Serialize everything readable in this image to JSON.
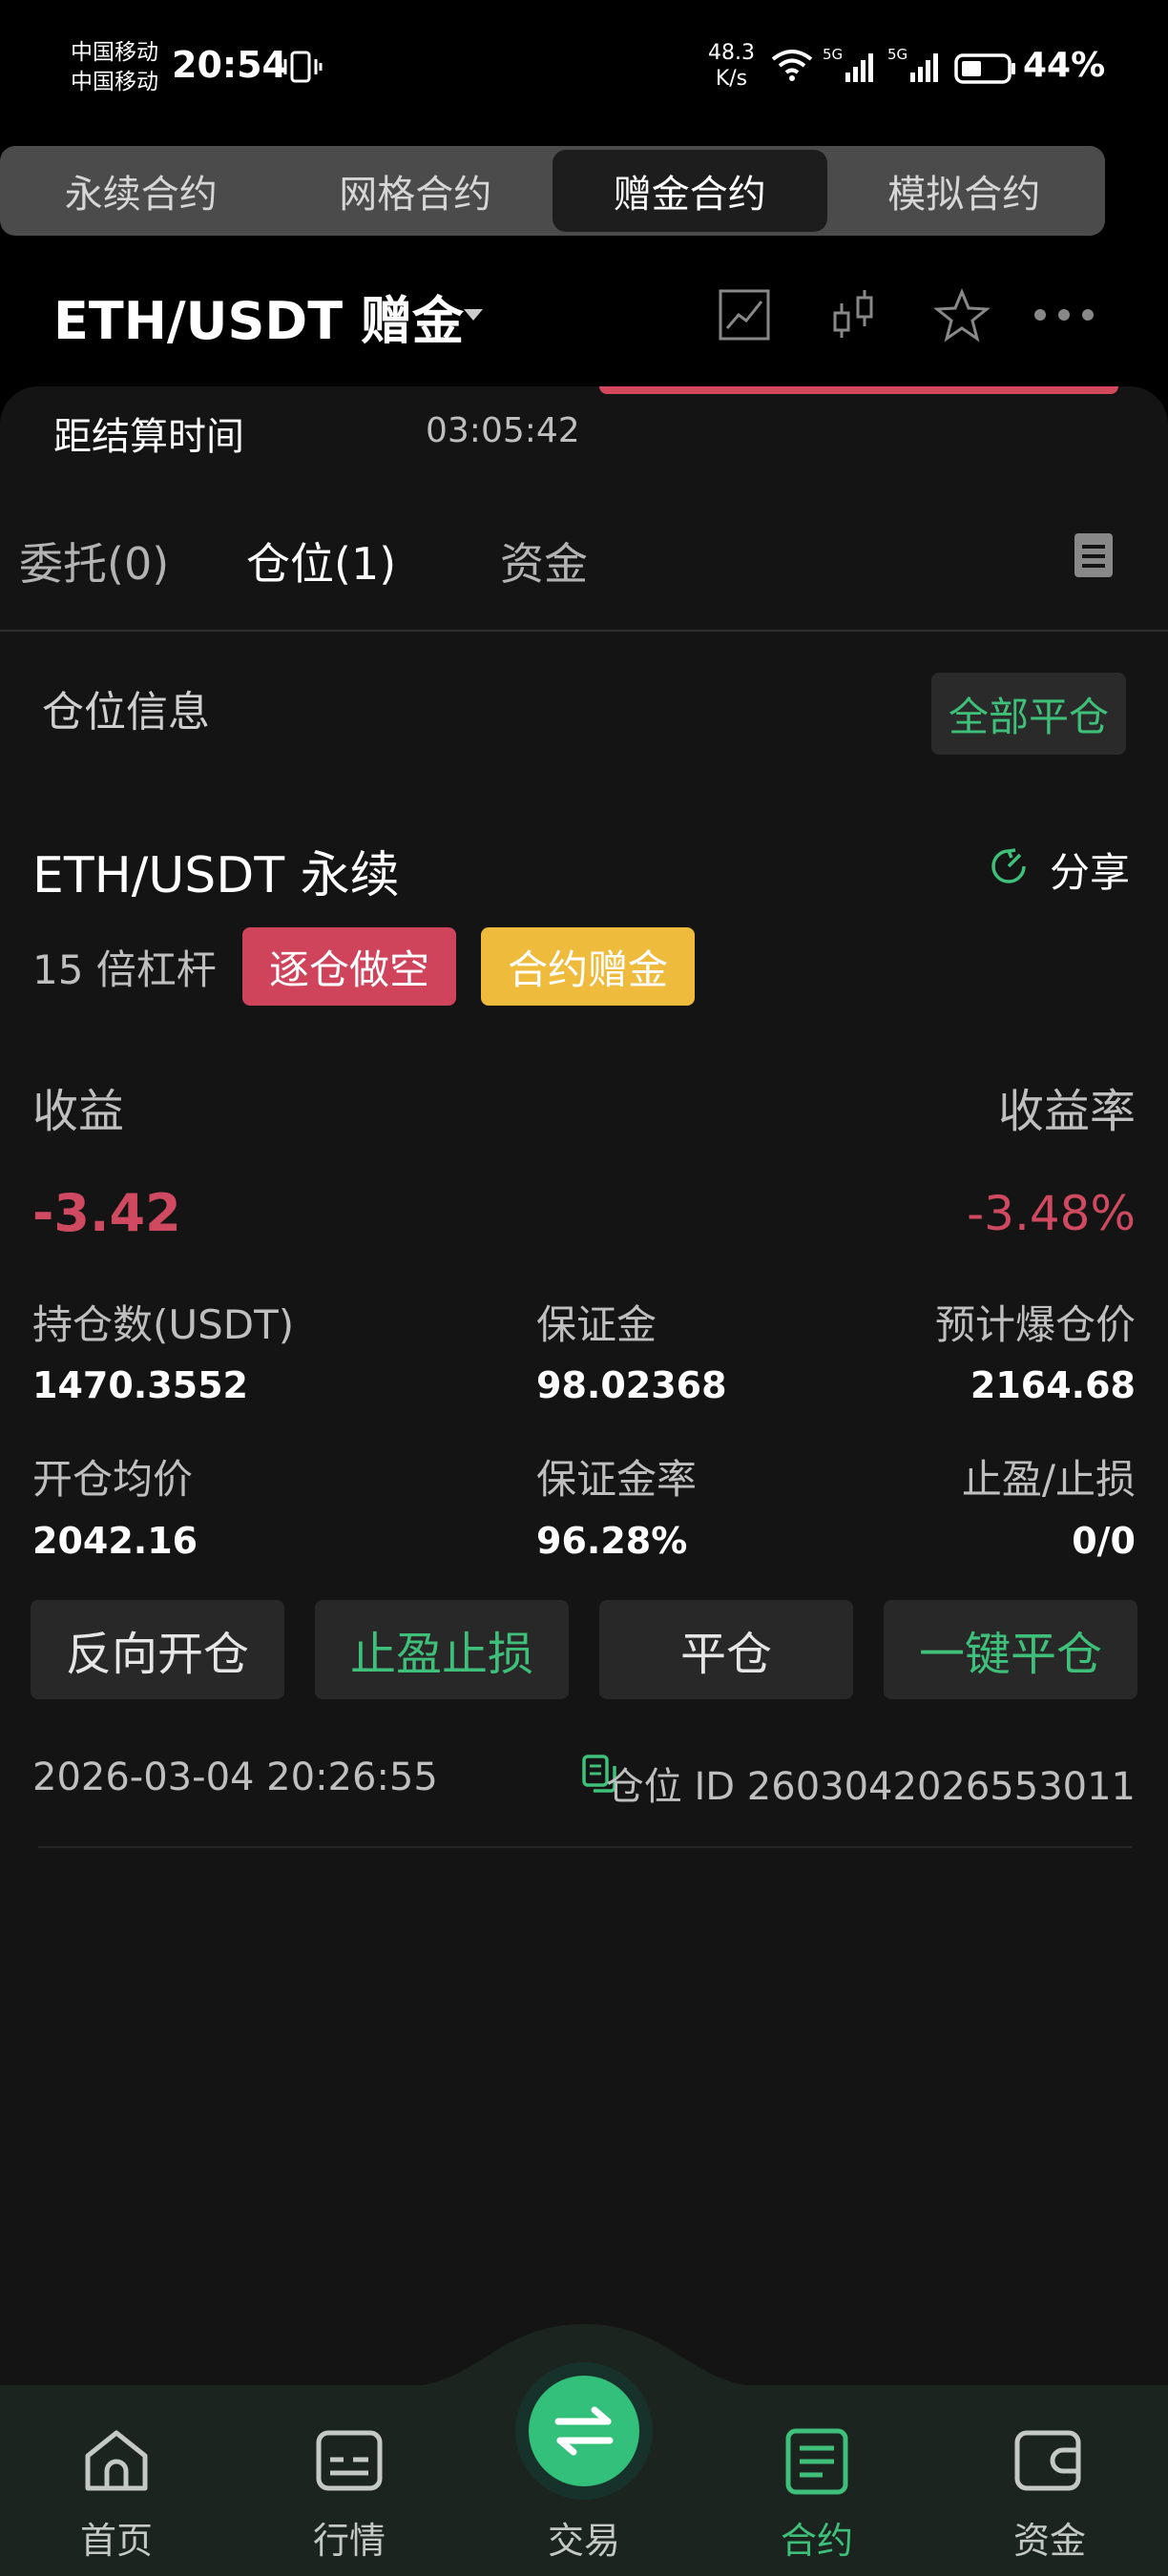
{
  "status_bar": {
    "carrier_1": "中国移动",
    "carrier_2": "中国移动",
    "time": "20:54",
    "net_speed_value": "48.3",
    "net_speed_unit": "K/s",
    "signal_1": "5G",
    "signal_2": "5G",
    "battery": "44%"
  },
  "contract_tabs": [
    {
      "label": "永续合约",
      "active": false
    },
    {
      "label": "网格合约",
      "active": false
    },
    {
      "label": "赠金合约",
      "active": true
    },
    {
      "label": "模拟合约",
      "active": false
    }
  ],
  "header": {
    "pair": "ETH/USDT  赠金",
    "icons": [
      "chart-line-icon",
      "candlestick-icon",
      "star-icon",
      "more-icon"
    ]
  },
  "countdown": {
    "label": "距结算时间",
    "value": "03:05:42"
  },
  "sub_tabs": [
    {
      "label": "委托(0)",
      "active": false
    },
    {
      "label": "仓位(1)",
      "active": true
    },
    {
      "label": "资金",
      "active": false
    }
  ],
  "position_section": {
    "title": "仓位信息",
    "close_all": "全部平仓"
  },
  "position": {
    "name": "ETH/USDT 永续",
    "share": "分享",
    "leverage": "15 倍杠杆",
    "badge_short": "逐仓做空",
    "badge_bonus": "合约赠金",
    "pnl_label": "收益",
    "pnl_rate_label": "收益率",
    "pnl": "-3.42",
    "pnl_rate": "-3.48%",
    "size_label": "持仓数(USDT)",
    "size": "1470.3552",
    "margin_label": "保证金",
    "margin": "98.02368",
    "liq_label": "预计爆仓价",
    "liq": "2164.68",
    "entry_label": "开仓均价",
    "entry": "2042.16",
    "margin_rate_label": "保证金率",
    "margin_rate": "96.28%",
    "tpsl_label": "止盈/止损",
    "tpsl": "0/0",
    "actions": {
      "reverse": "反向开仓",
      "tpsl": "止盈止损",
      "close": "平仓",
      "quick_close": "一键平仓"
    },
    "time": "2026-03-04 20:26:55",
    "id": "仓位 ID 2603042026553011"
  },
  "bottom_nav": [
    {
      "label": "首页",
      "icon": "home-icon"
    },
    {
      "label": "行情",
      "icon": "market-icon"
    },
    {
      "label": "交易",
      "icon": "swap-icon"
    },
    {
      "label": "合约",
      "icon": "contract-icon",
      "active": true
    },
    {
      "label": "资金",
      "icon": "wallet-icon"
    }
  ],
  "colors": {
    "accent_green": "#3fc07a",
    "loss_red": "#cf4a60",
    "bonus_yellow": "#efbb3c",
    "panel_bg": "#141414"
  }
}
